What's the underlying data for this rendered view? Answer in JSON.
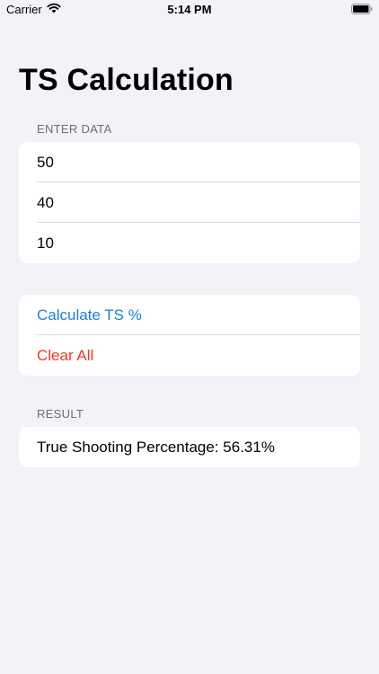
{
  "status_bar": {
    "carrier": "Carrier",
    "time": "5:14 PM",
    "icons": [
      "wifi-icon",
      "battery-icon"
    ]
  },
  "title": "TS Calculation",
  "enter_data": {
    "header": "ENTER DATA",
    "fields": [
      {
        "value": "50"
      },
      {
        "value": "40"
      },
      {
        "value": "10"
      }
    ]
  },
  "actions": {
    "calculate_label": "Calculate TS %",
    "clear_label": "Clear All",
    "calculate_color": "#1a7fd6",
    "clear_color": "#f0372d"
  },
  "result": {
    "header": "RESULT",
    "text": "True Shooting Percentage: 56.31%"
  }
}
